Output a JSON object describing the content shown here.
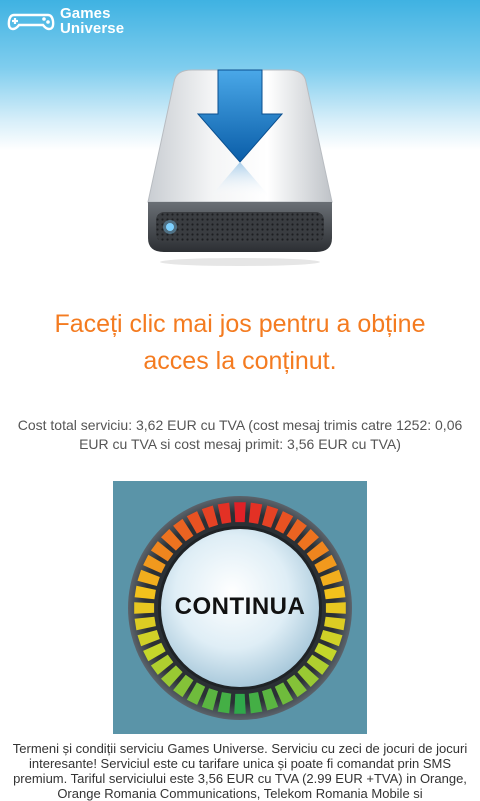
{
  "header": {
    "logo_line1": "Games",
    "logo_line2": "Universe"
  },
  "main": {
    "headline_line1": "Faceți clic mai jos pentru a obține",
    "headline_line2": "acces la conținut.",
    "cost_text": "Cost total serviciu: 3,62 EUR cu TVA (cost mesaj trimis catre 1252: 0,06 EUR cu TVA si cost mesaj primit: 3,56 EUR cu TVA)",
    "continue_label": "CONTINUA"
  },
  "footer": {
    "terms_text": "Termeni și condiții serviciu Games Universe. Serviciu cu zeci de jocuri de jocuri interesante! Serviciul este cu tarifare unica și poate fi comandat prin SMS premium. Tariful serviciului este 3,56 EUR cu TVA (2.99 EUR +TVA) in Orange, Orange Romania Communications, Telekom Romania Mobile si"
  },
  "colors": {
    "accent_orange": "#f47b20",
    "header_blue": "#3fb2e2",
    "button_bg": "#5a94a8"
  },
  "icons": {
    "logo": "gamepad-icon",
    "illustration": "download-drive-icon",
    "gauge": "gauge-dial-icon"
  }
}
